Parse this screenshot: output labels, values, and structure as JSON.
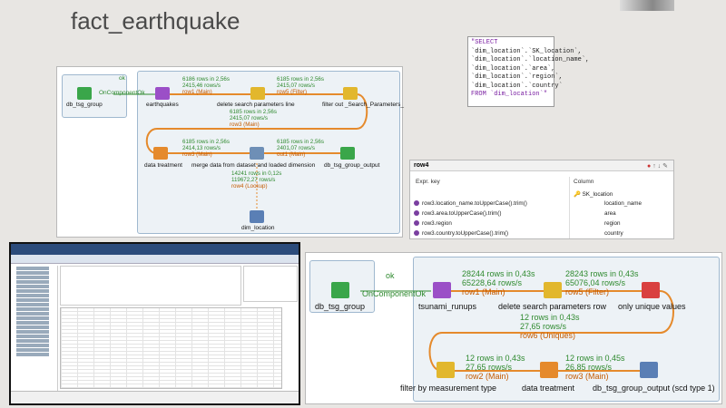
{
  "slide": {
    "title": "fact_earthquake"
  },
  "job1": {
    "ok": "ok",
    "on_component_ok": "OnComponentOk",
    "components": {
      "db_tsg_group": "db_tsg_group",
      "earthquakes": "earthquakes",
      "delete_search": "delete search parameters line",
      "filter_out": "filter out _Search_Parameters_",
      "data_treatment": "data treatment",
      "merge": "merge data from dataset and loaded dimension",
      "output": "db_tsg_group_output",
      "dim_location": "dim_location"
    },
    "flows": {
      "row1": {
        "rows": "6186 rows in 2,56s",
        "rate": "2415,46 rows/s",
        "name": "row1 (Main)"
      },
      "row5": {
        "rows": "6185 rows in 2,56s",
        "rate": "2415,07 rows/s",
        "name": "row5 (Filter)"
      },
      "row3": {
        "rows": "6185 rows in 2,56s",
        "rate": "2415,07 rows/s",
        "name": "row3 (Main)"
      },
      "row3b": {
        "rows": "6185 rows in 2,56s",
        "rate": "2414,13 rows/s",
        "name": "row3 (Main)"
      },
      "out1": {
        "rows": "6185 rows in 2,56s",
        "rate": "2401,07 rows/s",
        "name": "out1 (Main)"
      },
      "row4": {
        "rows": "14241 rows in 0,12s",
        "rate": "119672,27 rows/s",
        "name": "row4 (Lookup)"
      }
    }
  },
  "sql": {
    "lines": [
      "\"SELECT",
      " `dim_location`.`SK_location`,",
      " `dim_location`.`location_name`,",
      " `dim_location`.`area`,",
      " `dim_location`.`region`,",
      " `dim_location`.`country`",
      "FROM `dim_location`\""
    ]
  },
  "row4_panel": {
    "title": "row4",
    "col_expr": "Expr. key",
    "col_column": "Column",
    "rows": [
      {
        "expr": "",
        "column": "SK_location"
      },
      {
        "expr": "row3.location_name.toUpperCase().trim()",
        "column": "location_name"
      },
      {
        "expr": "row3.area.toUpperCase().trim()",
        "column": "area"
      },
      {
        "expr": "row3.region",
        "column": "region"
      },
      {
        "expr": "row3.country.toUpperCase().trim()",
        "column": "country"
      }
    ]
  },
  "job2": {
    "ok": "ok",
    "on_component_ok": "OnComponentOk",
    "components": {
      "db_tsg_group": "db_tsg_group",
      "tsunami_runups": "tsunami_runups",
      "delete_search": "delete search parameters row",
      "unique": "only unique values",
      "filter_measure": "filter by measurement type",
      "data_treatment": "data treatment",
      "output": "db_tsg_group_output (scd type 1)"
    },
    "flows": {
      "row1": {
        "rows": "28244 rows in 0,43s",
        "rate": "65228,64 rows/s",
        "name": "row1 (Main)"
      },
      "row5": {
        "rows": "28243 rows in 0,43s",
        "rate": "65076,04 rows/s",
        "name": "row5 (Filter)"
      },
      "row6": {
        "rows": "12 rows in 0,43s",
        "rate": "27,65 rows/s",
        "name": "row6 (Uniques)"
      },
      "row2": {
        "rows": "12 rows in 0,43s",
        "rate": "27,65 rows/s",
        "name": "row2 (Main)"
      },
      "row3": {
        "rows": "12 rows in 0,45s",
        "rate": "26,85 rows/s",
        "name": "row3 (Main)"
      }
    }
  },
  "colors": {
    "flow_orange": "#e58a2c",
    "ok_green": "#2f8a2f",
    "stats_green": "#2f8a2f"
  }
}
